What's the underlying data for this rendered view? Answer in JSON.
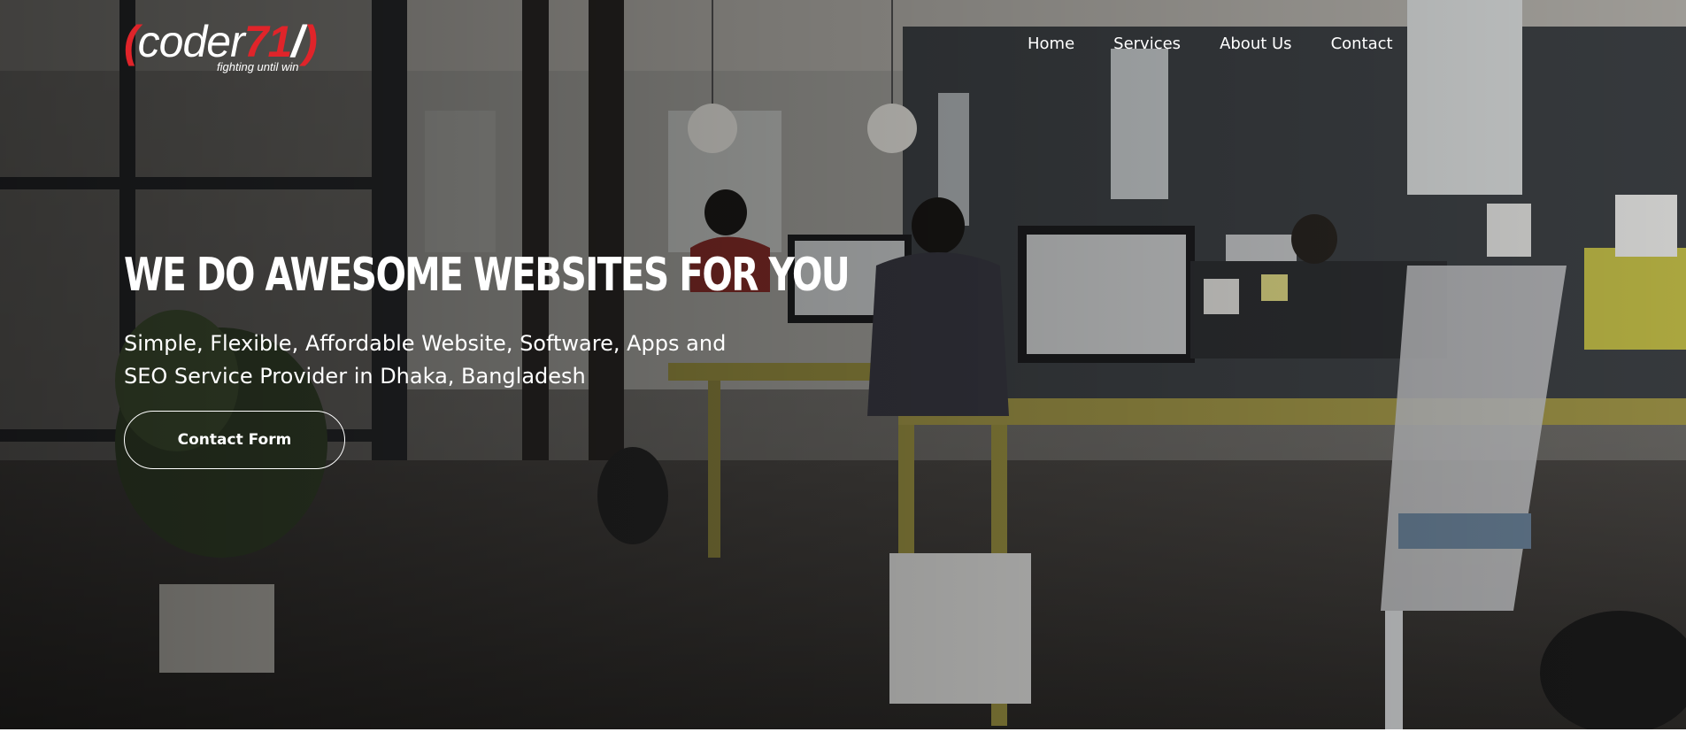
{
  "logo": {
    "open_bracket": "(",
    "word": "coder",
    "number": "71",
    "slash": "/",
    "close_bracket": ")",
    "tagline": "fighting until win",
    "accent_color": "#e0242a"
  },
  "nav": {
    "items": [
      {
        "label": "Home"
      },
      {
        "label": "Services"
      },
      {
        "label": "About Us"
      },
      {
        "label": "Contact"
      }
    ]
  },
  "hero": {
    "headline": "WE DO AWESOME WEBSITES FOR YOU",
    "subtext_line1": "Simple, Flexible, Affordable Website, Software, Apps and",
    "subtext_line2": "SEO Service Provider in Dhaka, Bangladesh",
    "cta_label": "Contact Form",
    "background": "office-photo"
  }
}
